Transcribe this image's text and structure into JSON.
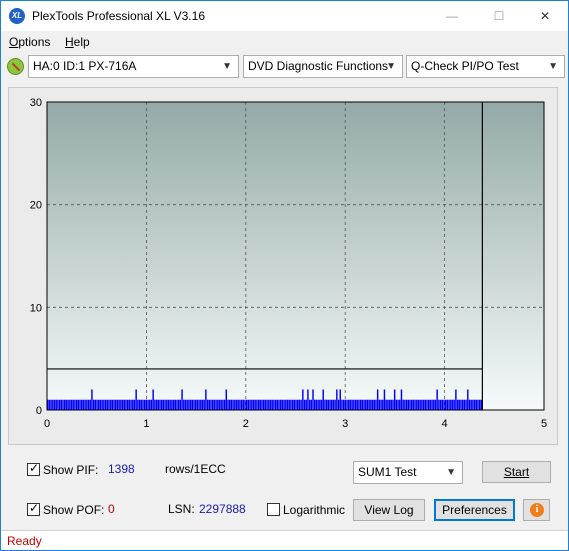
{
  "window": {
    "title": "PlexTools Professional XL V3.16",
    "icon_label": "XL"
  },
  "titlebar_buttons": {
    "minimize": "—",
    "maximize": "☐",
    "close": "✕"
  },
  "menu": [
    {
      "label": "Options",
      "hotkey": "O",
      "rest": "ptions"
    },
    {
      "label": "Help",
      "hotkey": "H",
      "rest": "elp"
    }
  ],
  "toolbar": {
    "drive": "HA:0 ID:1  PX-716A",
    "function": "DVD Diagnostic Functions",
    "test": "Q-Check PI/PO Test"
  },
  "chart_data": {
    "type": "bar",
    "title": "",
    "xlabel": "",
    "ylabel": "",
    "xlim": [
      0,
      5
    ],
    "ylim": [
      0,
      30
    ],
    "x_ticks": [
      "0",
      "1",
      "2",
      "3",
      "4",
      "5"
    ],
    "y_ticks": [
      "0",
      "10",
      "20",
      "30"
    ],
    "grid": true,
    "data_end_x": 4.38,
    "threshold_y": 4,
    "bar_color": "#0000ff",
    "series": [
      {
        "values": [
          1,
          1,
          1,
          1,
          1,
          1,
          1,
          1,
          1,
          1,
          1,
          1,
          1,
          1,
          1,
          1,
          1,
          1,
          1,
          1,
          1,
          1,
          1,
          1,
          1,
          1,
          2,
          1,
          1,
          1,
          1,
          1,
          1,
          1,
          1,
          1,
          1,
          1,
          1,
          1,
          1,
          1,
          1,
          1,
          1,
          1,
          1,
          1,
          1,
          1,
          1,
          1,
          2,
          1,
          1,
          1,
          1,
          1,
          1,
          1,
          1,
          1,
          2,
          1,
          1,
          1,
          1,
          1,
          1,
          1,
          1,
          1,
          1,
          1,
          1,
          1,
          1,
          1,
          1,
          2,
          1,
          1,
          1,
          1,
          1,
          1,
          1,
          1,
          1,
          1,
          1,
          1,
          1,
          2,
          1,
          1,
          1,
          1,
          1,
          1,
          1,
          1,
          1,
          1,
          1,
          2,
          1,
          1,
          1,
          1,
          1,
          1,
          1,
          1,
          1,
          1,
          1,
          1,
          1,
          1,
          1,
          1,
          1,
          1,
          1,
          1,
          1,
          1,
          1,
          1,
          1,
          1,
          1,
          1,
          1,
          1,
          1,
          1,
          1,
          1,
          1,
          1,
          1,
          1,
          1,
          1,
          1,
          1,
          1,
          1,
          2,
          1,
          1,
          2,
          1,
          1,
          2,
          1,
          1,
          1,
          1,
          1,
          2,
          1,
          1,
          1,
          1,
          1,
          1,
          1,
          2,
          1,
          2,
          1,
          1,
          1,
          1,
          1,
          1,
          1,
          1,
          1,
          1,
          1,
          1,
          1,
          1,
          1,
          1,
          1,
          1,
          1,
          1,
          1,
          2,
          1,
          1,
          1,
          2,
          1,
          1,
          1,
          1,
          1,
          2,
          1,
          1,
          1,
          2,
          1,
          1,
          1,
          1,
          1,
          1,
          1,
          1,
          1,
          1,
          1,
          1,
          1,
          1,
          1,
          1,
          1,
          1,
          1,
          1,
          2,
          1,
          1,
          1,
          1,
          1,
          1,
          1,
          1,
          1,
          1,
          2,
          1,
          1,
          1,
          1,
          1,
          1,
          2,
          1,
          1,
          1,
          1,
          1,
          1,
          1,
          1
        ]
      }
    ]
  },
  "controls": {
    "show_pif_label": "Show PIF:",
    "pif_value": "1398",
    "units": "rows/1ECC",
    "show_pof_label": "Show POF:",
    "pof_value": "0",
    "lsn_label": "LSN:",
    "lsn_value": "2297888",
    "logarithmic_label": "Logarithmic",
    "test_select": "SUM1 Test",
    "start_label": "Start",
    "view_log_label": "View Log",
    "preferences_label": "Preferences",
    "info_symbol": "i"
  },
  "status": {
    "text": "Ready"
  },
  "colors": {
    "accent": "#0078d7",
    "status": "#c00000",
    "pif_value": "#1a1ab0",
    "pof_value": "#c00000"
  }
}
